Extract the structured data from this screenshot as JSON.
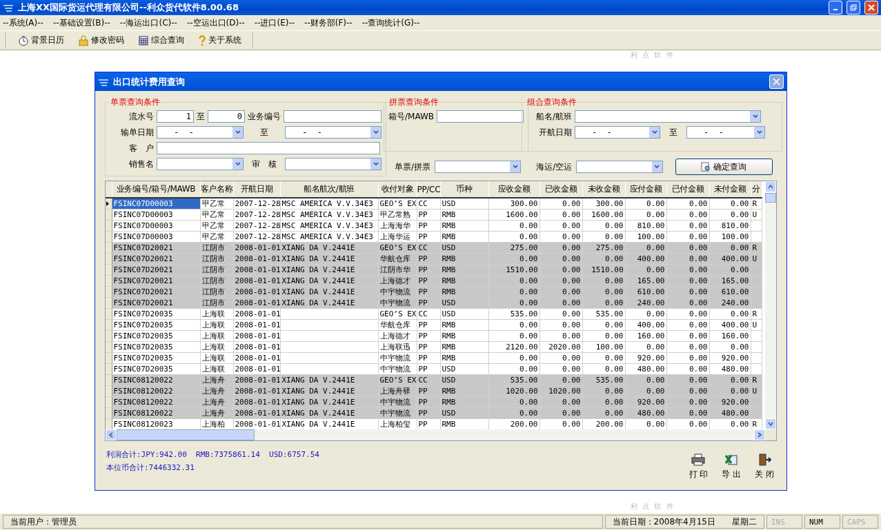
{
  "window": {
    "title": "上海XX国际货运代理有限公司--利众货代软件8.00.68"
  },
  "menu": [
    "--系统(A)--",
    "--基础设置(B)--",
    "--海运出口(C)--",
    "--空运出口(D)--",
    "--进口(E)--",
    "--财务部(F)--",
    "--查询统计(G)--"
  ],
  "toolbar": [
    {
      "kind": "clock",
      "label": "背景日历"
    },
    {
      "kind": "lock",
      "label": "修改密码"
    },
    {
      "kind": "grid",
      "label": "综合查询"
    },
    {
      "kind": "help",
      "label": "关于系统"
    }
  ],
  "background_caption": [
    "利 点 软 件",
    "利 点 软 件"
  ],
  "dialog": {
    "title": "出口统计费用查询",
    "single": {
      "legend": "单票查询条件",
      "serial_label": "流水号",
      "serial_from": "1",
      "to_label": "至",
      "serial_to": "0",
      "business_label": "业务编号",
      "date_label": "输单日期",
      "date_from": "-  -",
      "date_to_label": "至",
      "date_to": "-  -",
      "customer_label": "客　户",
      "sales_label": "销售名",
      "audit_label": "审　核"
    },
    "consol": {
      "legend": "拼票查询条件",
      "box_label": "箱号/MAWB"
    },
    "combo": {
      "legend": "组合查询条件",
      "vessel_label": "船名/航班",
      "sail_label": "开航日期",
      "sail_from": "-  -",
      "to_label": "至",
      "sail_to": "-  -"
    },
    "type_label": "单票/拼票",
    "mode_label": "海运/空运",
    "query_button": "确定查询",
    "table": {
      "columns": [
        "业务编号/箱号/MAWB",
        "客户名称",
        "开航日期",
        "船名航次/航班",
        "收付对象",
        "PP/CC",
        "币种",
        "应收金额",
        "已收金额",
        "未收金额",
        "应付金额",
        "已付金额",
        "未付金额",
        "分"
      ],
      "rows": [
        {
          "selected": true,
          "shaded": false,
          "cells": [
            "FSINC07D00003",
            "甲乙常",
            "2007-12-28",
            "MSC AMERICA V.V.34E3",
            "GEO’S EX",
            "CC",
            "USD",
            "300.00",
            "0.00",
            "300.00",
            "0.00",
            "0.00",
            "0.00",
            "R"
          ]
        },
        {
          "selected": false,
          "shaded": false,
          "cells": [
            "FSINC07D00003",
            "甲乙常",
            "2007-12-28",
            "MSC AMERICA V.V.34E3",
            "甲乙常熟",
            "PP",
            "RMB",
            "1600.00",
            "0.00",
            "1600.00",
            "0.00",
            "0.00",
            "0.00",
            "U"
          ]
        },
        {
          "selected": false,
          "shaded": false,
          "cells": [
            "FSINC07D00003",
            "甲乙常",
            "2007-12-28",
            "MSC AMERICA V.V.34E3",
            "上海海华",
            "PP",
            "RMB",
            "0.00",
            "0.00",
            "0.00",
            "810.00",
            "0.00",
            "810.00",
            ""
          ]
        },
        {
          "selected": false,
          "shaded": false,
          "cells": [
            "FSINC07D00003",
            "甲乙常",
            "2007-12-28",
            "MSC AMERICA V.V.34E3",
            "上海华运",
            "PP",
            "RMB",
            "0.00",
            "0.00",
            "0.00",
            "100.00",
            "0.00",
            "100.00",
            ""
          ]
        },
        {
          "selected": false,
          "shaded": true,
          "cells": [
            "FSINC07D20021",
            "江阴市",
            "2008-01-01",
            "XIANG DA V.2441E",
            "GEO’S EX",
            "CC",
            "USD",
            "275.00",
            "0.00",
            "275.00",
            "0.00",
            "0.00",
            "0.00",
            "R"
          ]
        },
        {
          "selected": false,
          "shaded": true,
          "cells": [
            "FSINC07D20021",
            "江阴市",
            "2008-01-01",
            "XIANG DA V.2441E",
            "华航仓库",
            "PP",
            "RMB",
            "0.00",
            "0.00",
            "0.00",
            "400.00",
            "0.00",
            "400.00",
            "U"
          ]
        },
        {
          "selected": false,
          "shaded": true,
          "cells": [
            "FSINC07D20021",
            "江阴市",
            "2008-01-01",
            "XIANG DA V.2441E",
            "江阴市华",
            "PP",
            "RMB",
            "1510.00",
            "0.00",
            "1510.00",
            "0.00",
            "0.00",
            "0.00",
            ""
          ]
        },
        {
          "selected": false,
          "shaded": true,
          "cells": [
            "FSINC07D20021",
            "江阴市",
            "2008-01-01",
            "XIANG DA V.2441E",
            "上海德才",
            "PP",
            "RMB",
            "0.00",
            "0.00",
            "0.00",
            "165.00",
            "0.00",
            "165.00",
            ""
          ]
        },
        {
          "selected": false,
          "shaded": true,
          "cells": [
            "FSINC07D20021",
            "江阴市",
            "2008-01-01",
            "XIANG DA V.2441E",
            "中宇物流",
            "PP",
            "RMB",
            "0.00",
            "0.00",
            "0.00",
            "610.00",
            "0.00",
            "610.00",
            ""
          ]
        },
        {
          "selected": false,
          "shaded": true,
          "cells": [
            "FSINC07D20021",
            "江阴市",
            "2008-01-01",
            "XIANG DA V.2441E",
            "中宇物流",
            "PP",
            "USD",
            "0.00",
            "0.00",
            "0.00",
            "240.00",
            "0.00",
            "240.00",
            ""
          ]
        },
        {
          "selected": false,
          "shaded": false,
          "cells": [
            "FSINC07D20035",
            "上海联",
            "2008-01-01",
            "",
            "GEO’S EX",
            "CC",
            "USD",
            "535.00",
            "0.00",
            "535.00",
            "0.00",
            "0.00",
            "0.00",
            "R"
          ]
        },
        {
          "selected": false,
          "shaded": false,
          "cells": [
            "FSINC07D20035",
            "上海联",
            "2008-01-01",
            "",
            "华航仓库",
            "PP",
            "RMB",
            "0.00",
            "0.00",
            "0.00",
            "400.00",
            "0.00",
            "400.00",
            "U"
          ]
        },
        {
          "selected": false,
          "shaded": false,
          "cells": [
            "FSINC07D20035",
            "上海联",
            "2008-01-01",
            "",
            "上海德才",
            "PP",
            "RMB",
            "0.00",
            "0.00",
            "0.00",
            "160.00",
            "0.00",
            "160.00",
            ""
          ]
        },
        {
          "selected": false,
          "shaded": false,
          "cells": [
            "FSINC07D20035",
            "上海联",
            "2008-01-01",
            "",
            "上海联迅",
            "PP",
            "RMB",
            "2120.00",
            "2020.00",
            "100.00",
            "0.00",
            "0.00",
            "0.00",
            ""
          ]
        },
        {
          "selected": false,
          "shaded": false,
          "cells": [
            "FSINC07D20035",
            "上海联",
            "2008-01-01",
            "",
            "中宇物流",
            "PP",
            "RMB",
            "0.00",
            "0.00",
            "0.00",
            "920.00",
            "0.00",
            "920.00",
            ""
          ]
        },
        {
          "selected": false,
          "shaded": false,
          "cells": [
            "FSINC07D20035",
            "上海联",
            "2008-01-01",
            "",
            "中宇物流",
            "PP",
            "USD",
            "0.00",
            "0.00",
            "0.00",
            "480.00",
            "0.00",
            "480.00",
            ""
          ]
        },
        {
          "selected": false,
          "shaded": true,
          "cells": [
            "FSINC08120022",
            "上海舟",
            "2008-01-01",
            "XIANG DA V.2441E",
            "GEO’S EX",
            "CC",
            "USD",
            "535.00",
            "0.00",
            "535.00",
            "0.00",
            "0.00",
            "0.00",
            "R"
          ]
        },
        {
          "selected": false,
          "shaded": true,
          "cells": [
            "FSINC08120022",
            "上海舟",
            "2008-01-01",
            "XIANG DA V.2441E",
            "上海舟驿",
            "PP",
            "RMB",
            "1020.00",
            "1020.00",
            "0.00",
            "0.00",
            "0.00",
            "0.00",
            "U"
          ]
        },
        {
          "selected": false,
          "shaded": true,
          "cells": [
            "FSINC08120022",
            "上海舟",
            "2008-01-01",
            "XIANG DA V.2441E",
            "中宇物流",
            "PP",
            "RMB",
            "0.00",
            "0.00",
            "0.00",
            "920.00",
            "0.00",
            "920.00",
            ""
          ]
        },
        {
          "selected": false,
          "shaded": true,
          "cells": [
            "FSINC08120022",
            "上海舟",
            "2008-01-01",
            "XIANG DA V.2441E",
            "中宇物流",
            "PP",
            "USD",
            "0.00",
            "0.00",
            "0.00",
            "480.00",
            "0.00",
            "480.00",
            ""
          ]
        },
        {
          "selected": false,
          "shaded": false,
          "cells": [
            "FSINC08120023",
            "上海柏",
            "2008-01-01",
            "XIANG DA V.2441E",
            "上海柏玺",
            "PP",
            "RMB",
            "200.00",
            "0.00",
            "200.00",
            "0.00",
            "0.00",
            "0.00",
            "R"
          ]
        }
      ]
    },
    "totals": [
      "利润合计:JPY:942.00  RMB:7375861.14  USD:6757.54",
      "本位币合计:7446332.31"
    ],
    "actions": [
      {
        "kind": "print",
        "label": "打 印"
      },
      {
        "kind": "export",
        "label": "导 出"
      },
      {
        "kind": "close",
        "label": "关 闭"
      }
    ]
  },
  "status_bar": {
    "user": "当前用户：管理员",
    "date": "当前日期：2008年4月15日",
    "weekday": "星期二",
    "keys": [
      {
        "label": "INS",
        "on": false
      },
      {
        "label": "NUM",
        "on": true
      },
      {
        "label": "CAPS",
        "on": false
      }
    ]
  }
}
